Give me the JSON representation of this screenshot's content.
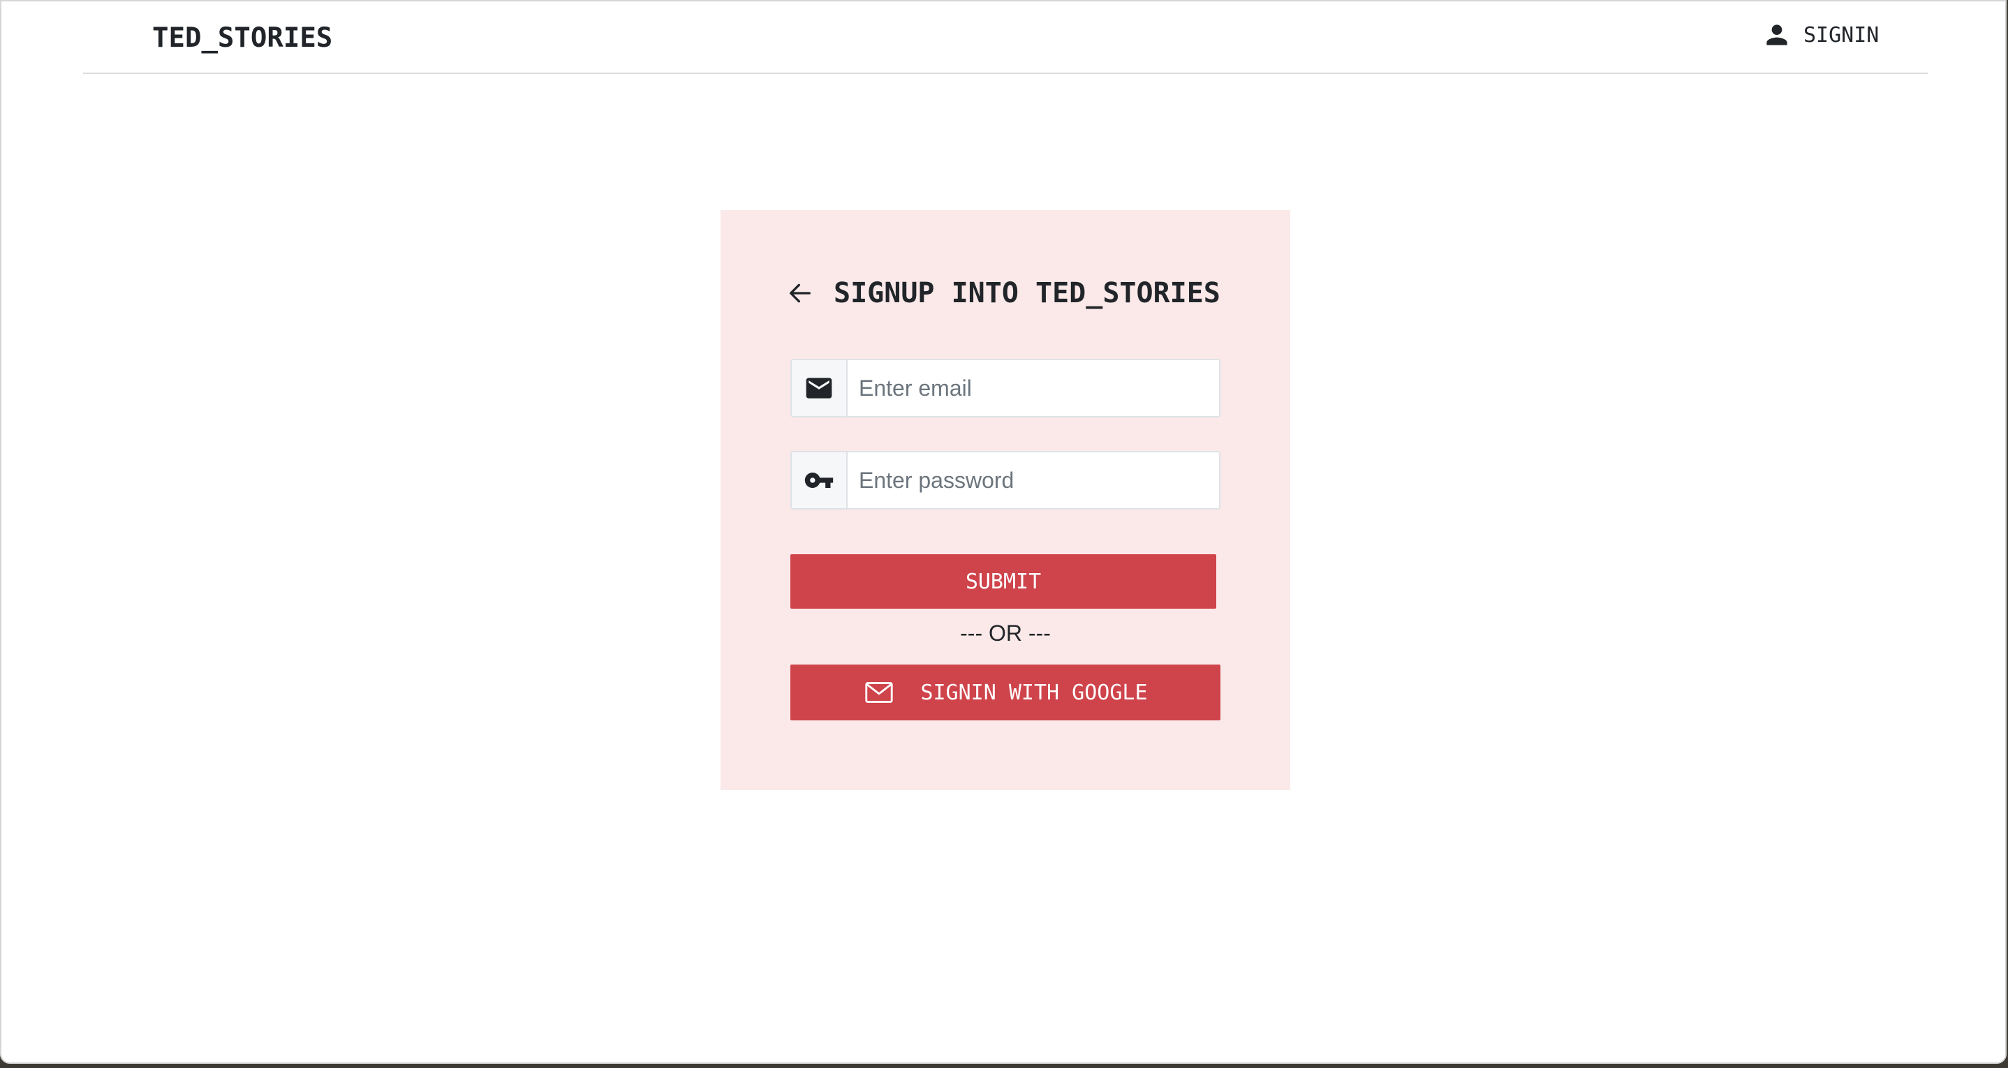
{
  "navbar": {
    "brand": "TED_STORIES",
    "signin": {
      "label": "SIGNIN",
      "icon": "person-icon"
    }
  },
  "signup_card": {
    "back_icon": "arrow-left-icon",
    "title": "SIGNUP INTO TED_STORIES",
    "email": {
      "icon": "envelope-icon",
      "placeholder": "Enter email",
      "value": ""
    },
    "password": {
      "icon": "key-icon",
      "placeholder": "Enter password",
      "value": ""
    },
    "submit_label": "SUBMIT",
    "divider": "--- OR ---",
    "google": {
      "icon": "envelope-outline-icon",
      "label": "SIGNIN WITH GOOGLE"
    }
  },
  "colors": {
    "accent": "#cf434b",
    "card_background": "#fbe9e9",
    "text": "#212529"
  }
}
